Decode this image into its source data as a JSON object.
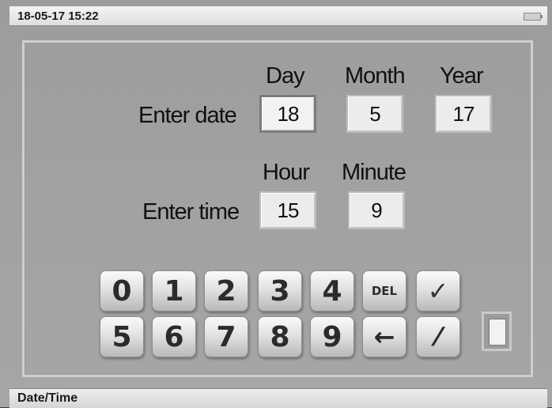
{
  "status": {
    "datetime": "18-05-17 15:22",
    "battery_icon": "battery-icon"
  },
  "date": {
    "prompt": "Enter date",
    "headers": {
      "day": "Day",
      "month": "Month",
      "year": "Year"
    },
    "values": {
      "day": "18",
      "month": "5",
      "year": "17"
    },
    "active_field": "day"
  },
  "time": {
    "prompt": "Enter time",
    "headers": {
      "hour": "Hour",
      "minute": "Minute"
    },
    "values": {
      "hour": "15",
      "minute": "9"
    }
  },
  "keypad": {
    "k0": "0",
    "k1": "1",
    "k2": "2",
    "k3": "3",
    "k4": "4",
    "k5": "5",
    "k6": "6",
    "k7": "7",
    "k8": "8",
    "k9": "9",
    "del": "DEL",
    "confirm": "✓",
    "back": "←",
    "sep": "⁄"
  },
  "footer": {
    "title": "Date/Time"
  }
}
